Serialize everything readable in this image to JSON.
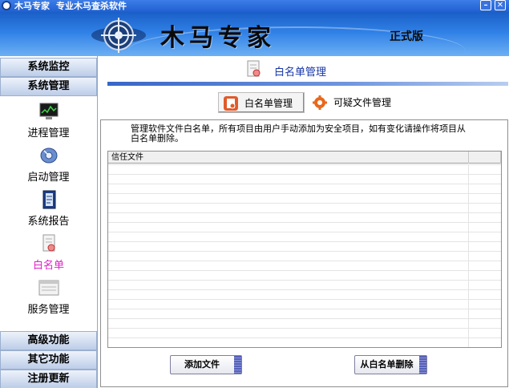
{
  "window": {
    "app_name": "木马专家",
    "subtitle": "专业木马查杀软件",
    "minimize_label": "–",
    "close_label": "✕"
  },
  "banner": {
    "brand": "木马专家",
    "edition": "正式版"
  },
  "sidebar": {
    "sections": {
      "monitor": "系统监控",
      "manage": "系统管理",
      "advanced": "高级功能",
      "other": "其它功能",
      "register": "注册更新"
    },
    "items": [
      {
        "label": "进程管理",
        "icon": "monitor-icon"
      },
      {
        "label": "启动管理",
        "icon": "disc-icon"
      },
      {
        "label": "系统报告",
        "icon": "report-icon"
      },
      {
        "label": "白名单",
        "icon": "whitelist-icon",
        "active": true
      },
      {
        "label": "服务管理",
        "icon": "service-icon"
      }
    ],
    "active_color": "#e020c8"
  },
  "main": {
    "page_title": "白名单管理",
    "tabs": [
      {
        "label": "白名单管理",
        "icon": "whitelist-tab-icon",
        "selected": true
      },
      {
        "label": "可疑文件管理",
        "icon": "gear-icon",
        "selected": false
      }
    ],
    "description": "管理软件文件白名单，所有项目由用户手动添加为安全项目，如有变化请操作将项目从白名单删除。",
    "list": {
      "columns": [
        "信任文件",
        ""
      ],
      "rows": []
    },
    "buttons": {
      "add": "添加文件",
      "remove": "从白名单删除"
    }
  },
  "colors": {
    "title_blue": "#1636a8",
    "banner_blue": "#2f80e6"
  }
}
